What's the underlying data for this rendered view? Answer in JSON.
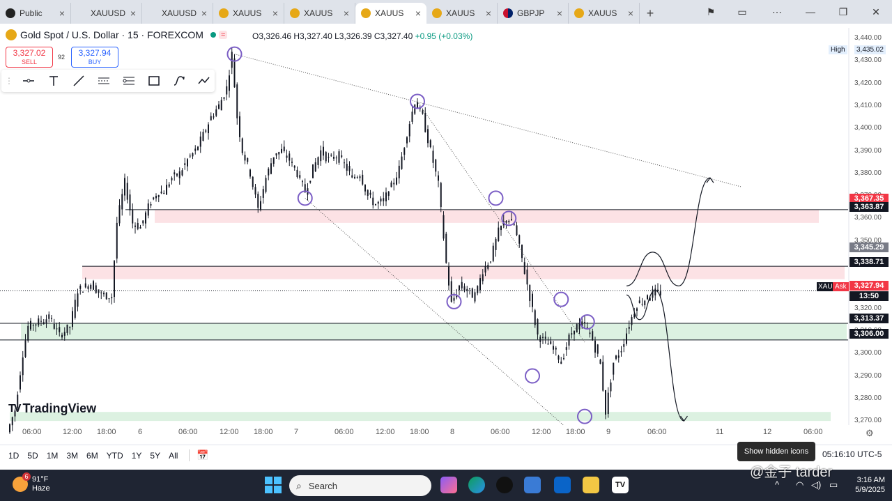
{
  "browser": {
    "tabs": [
      {
        "label": "Public",
        "icon": "globe-icon"
      },
      {
        "label": "XAUUSD C",
        "icon": "none"
      },
      {
        "label": "XAUUSD C",
        "icon": "none"
      },
      {
        "label": "XAUUS",
        "icon": "coin-icon"
      },
      {
        "label": "XAUUS",
        "icon": "coin-icon"
      },
      {
        "label": "XAUUS",
        "icon": "coin-icon",
        "active": true
      },
      {
        "label": "XAUUS",
        "icon": "coin-icon"
      },
      {
        "label": "GBPJP",
        "icon": "flag-icon"
      },
      {
        "label": "XAUUS",
        "icon": "coin-icon"
      }
    ],
    "new_tab": "+"
  },
  "header": {
    "symbol_title": "Gold Spot / U.S. Dollar · 15 · FOREXCOM",
    "ohlc_o": "O3,326.46",
    "ohlc_h": "H3,327.40",
    "ohlc_l": "L3,326.39",
    "ohlc_c": "C3,327.40",
    "change": "+0.95 (+0.03%)",
    "sell_price": "3,327.02",
    "sell_label": "SELL",
    "spread": "92",
    "buy_price": "3,327.94",
    "buy_label": "BUY"
  },
  "price_axis": {
    "ticks": [
      "3,440.00",
      "3,430.00",
      "3,420.00",
      "3,410.00",
      "3,400.00",
      "3,390.00",
      "3,380.00",
      "3,370.00",
      "3,360.00",
      "3,350.00",
      "3,340.00",
      "3,330.00",
      "3,320.00",
      "3,310.00",
      "3,300.00",
      "3,290.00",
      "3,280.00",
      "3,270.00"
    ],
    "high_label": "High",
    "high_value": "3,435.02",
    "labels": [
      {
        "text": "3,367.35",
        "color": "#f23645"
      },
      {
        "text": "3,363.87",
        "color": "#131722"
      },
      {
        "text": "3,345.29",
        "color": "#787b86"
      },
      {
        "text": "3,338.71",
        "color": "#131722"
      },
      {
        "text": "3,327.94",
        "color": "#f23645"
      },
      {
        "text": "13:50",
        "color": "#131722"
      },
      {
        "text": "3,313.37",
        "color": "#131722"
      },
      {
        "text": "3,306.00",
        "color": "#131722"
      }
    ],
    "symbol_tag": "XAU",
    "ask_tag": "Ask"
  },
  "time_axis": [
    "06:00",
    "12:00",
    "18:00",
    "6",
    "06:00",
    "12:00",
    "18:00",
    "7",
    "06:00",
    "12:00",
    "18:00",
    "8",
    "06:00",
    "12:00",
    "18:00",
    "9",
    "06:00",
    "11",
    "12",
    "06:00"
  ],
  "logo_text": "TradingView",
  "range_bar": {
    "ranges": [
      "1D",
      "5D",
      "1M",
      "3M",
      "6M",
      "YTD",
      "1Y",
      "5Y",
      "All"
    ],
    "clock": "05:16:10 UTC-5",
    "tooltip": "Show hidden icons"
  },
  "taskbar": {
    "temp": "91°F",
    "condition": "Haze",
    "weather_badge": "6",
    "search_placeholder": "Search",
    "time": "3:16 AM",
    "date": "5/9/2025",
    "watermark": "@金子 tarder"
  },
  "colors": {
    "up": "#089981",
    "down": "#f23645",
    "zone_red": "#fbdde0",
    "zone_green": "#d6efdc",
    "circle": "#7b5ec5",
    "buy": "#2962ff"
  },
  "chart_data": {
    "type": "candlestick",
    "title": "Gold Spot / U.S. Dollar · 15 · FOREXCOM",
    "ylim": [
      3265,
      3442
    ],
    "key_levels": [
      3363.87,
      3338.71,
      3313.37,
      3306.0
    ],
    "zones": [
      {
        "from": 3358.0,
        "to": 3363.87,
        "color": "red"
      },
      {
        "from": 3333.0,
        "to": 3338.71,
        "color": "red"
      },
      {
        "from": 3306.0,
        "to": 3313.37,
        "color": "green"
      },
      {
        "from": 3270.0,
        "to": 3274.0,
        "color": "green"
      }
    ],
    "path_points": [
      [
        0,
        3265
      ],
      [
        3,
        3275
      ],
      [
        6,
        3300
      ],
      [
        8,
        3312
      ],
      [
        12,
        3314
      ],
      [
        16,
        3316
      ],
      [
        20,
        3308
      ],
      [
        24,
        3312
      ],
      [
        27,
        3328
      ],
      [
        32,
        3331
      ],
      [
        36,
        3326
      ],
      [
        40,
        3325
      ],
      [
        42,
        3358
      ],
      [
        45,
        3376
      ],
      [
        48,
        3358
      ],
      [
        51,
        3356
      ],
      [
        54,
        3365
      ],
      [
        57,
        3371
      ],
      [
        60,
        3372
      ],
      [
        63,
        3378
      ],
      [
        66,
        3380
      ],
      [
        69,
        3386
      ],
      [
        72,
        3390
      ],
      [
        75,
        3397
      ],
      [
        78,
        3405
      ],
      [
        81,
        3410
      ],
      [
        84,
        3418
      ],
      [
        86,
        3433
      ],
      [
        88,
        3405
      ],
      [
        90,
        3390
      ],
      [
        93,
        3380
      ],
      [
        96,
        3364
      ],
      [
        99,
        3378
      ],
      [
        102,
        3388
      ],
      [
        105,
        3390
      ],
      [
        108,
        3386
      ],
      [
        111,
        3380
      ],
      [
        114,
        3372
      ],
      [
        117,
        3382
      ],
      [
        120,
        3390
      ],
      [
        123,
        3386
      ],
      [
        126,
        3388
      ],
      [
        129,
        3384
      ],
      [
        132,
        3378
      ],
      [
        135,
        3380
      ],
      [
        138,
        3370
      ],
      [
        141,
        3366
      ],
      [
        144,
        3368
      ],
      [
        147,
        3374
      ],
      [
        150,
        3382
      ],
      [
        153,
        3398
      ],
      [
        156,
        3412
      ],
      [
        159,
        3405
      ],
      [
        162,
        3390
      ],
      [
        165,
        3375
      ],
      [
        168,
        3340
      ],
      [
        170,
        3322
      ],
      [
        173,
        3330
      ],
      [
        176,
        3328
      ],
      [
        179,
        3325
      ],
      [
        182,
        3337
      ],
      [
        185,
        3342
      ],
      [
        188,
        3354
      ],
      [
        191,
        3360
      ],
      [
        194,
        3357
      ],
      [
        197,
        3342
      ],
      [
        200,
        3325
      ],
      [
        203,
        3308
      ],
      [
        206,
        3305
      ],
      [
        209,
        3303
      ],
      [
        212,
        3296
      ],
      [
        215,
        3307
      ],
      [
        218,
        3312
      ],
      [
        221,
        3313
      ],
      [
        224,
        3306
      ],
      [
        227,
        3295
      ],
      [
        229,
        3274
      ],
      [
        232,
        3296
      ],
      [
        235,
        3302
      ],
      [
        238,
        3313
      ],
      [
        241,
        3322
      ],
      [
        244,
        3324
      ],
      [
        247,
        3327
      ],
      [
        250,
        3327
      ]
    ],
    "trendlines": [
      {
        "from": [
          86,
          3433
        ],
        "to": [
          280,
          3374
        ]
      },
      {
        "from": [
          113,
          3369
        ],
        "to": [
          212,
          3268
        ]
      },
      {
        "from": [
          156,
          3412
        ],
        "to": [
          220,
          3305
        ]
      }
    ],
    "marked_points": [
      [
        86,
        3433
      ],
      [
        113,
        3369
      ],
      [
        156,
        3412
      ],
      [
        170,
        3323
      ],
      [
        186,
        3369
      ],
      [
        191,
        3360
      ],
      [
        200,
        3290
      ],
      [
        211,
        3324
      ],
      [
        220,
        3272
      ],
      [
        221,
        3314
      ]
    ],
    "projection_up": [
      [
        236,
        3330
      ],
      [
        246,
        3345
      ],
      [
        256,
        3330
      ],
      [
        268,
        3378
      ]
    ],
    "projection_down": [
      [
        236,
        3326
      ],
      [
        241,
        3315
      ],
      [
        247,
        3328
      ],
      [
        258,
        3270
      ]
    ]
  }
}
